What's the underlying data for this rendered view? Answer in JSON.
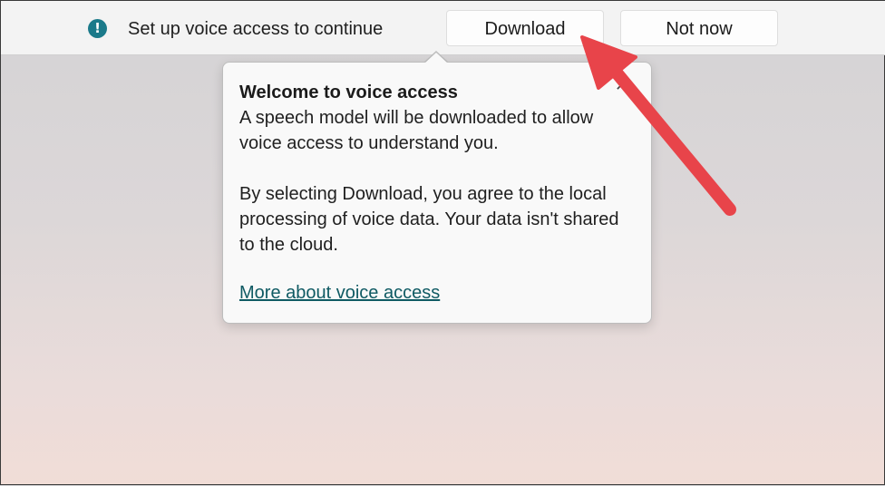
{
  "notification": {
    "icon": "info-icon",
    "icon_glyph": "!",
    "message": "Set up voice access to continue",
    "download_label": "Download",
    "not_now_label": "Not now"
  },
  "flyout": {
    "title": "Welcome to voice access",
    "close_glyph": "✕",
    "paragraph1": "A speech model will be downloaded to allow voice access to understand you.",
    "paragraph2": "By selecting Download, you agree to the local processing of voice data. Your data isn't shared to the cloud.",
    "link": "More about voice access"
  },
  "colors": {
    "info_icon": "#1b7a8a",
    "link": "#0f5a63",
    "annotation_arrow": "#e8444a"
  }
}
